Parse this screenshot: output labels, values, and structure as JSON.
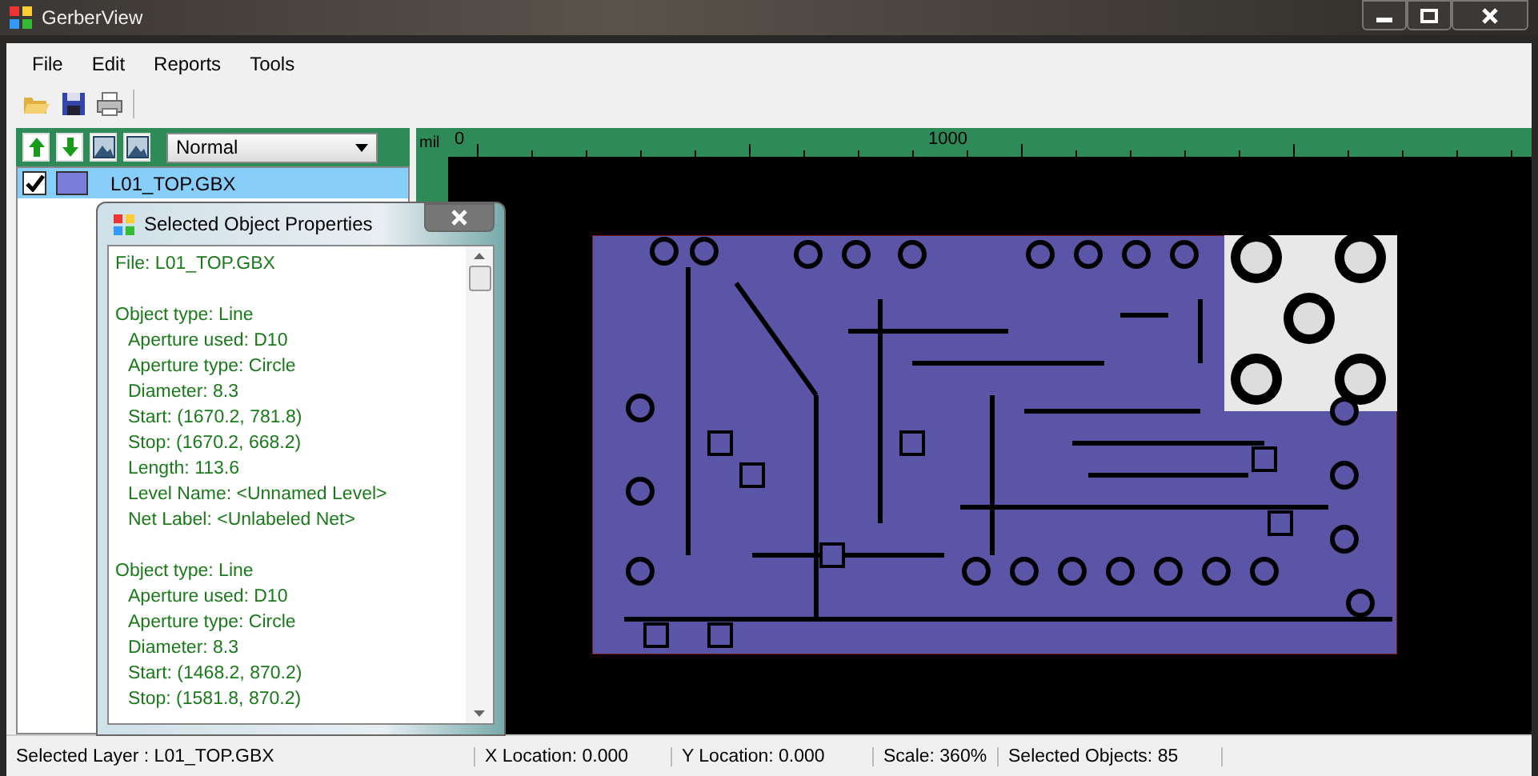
{
  "window": {
    "title": "GerberView"
  },
  "menu": [
    "File",
    "Edit",
    "Reports",
    "Tools"
  ],
  "layer_toolbar": {
    "view_mode": "Normal"
  },
  "layers": [
    {
      "name": "L01_TOP.GBX",
      "checked": true,
      "selected": true,
      "color": "#7b7bdb"
    }
  ],
  "ruler": {
    "unit": "mil",
    "labels": [
      "0",
      "1000"
    ]
  },
  "properties_dialog": {
    "title": "Selected Object Properties",
    "groups": [
      {
        "lines": [
          "File: L01_TOP.GBX"
        ]
      },
      {
        "lines": [
          "Object type: Line",
          "Aperture used: D10",
          "Aperture type: Circle",
          "Diameter: 8.3",
          "Start: (1670.2, 781.8)",
          "Stop: (1670.2, 668.2)",
          "Length: 113.6",
          "Level Name: <Unnamed Level>",
          "Net Label: <Unlabeled Net>"
        ]
      },
      {
        "lines": [
          "Object type: Line",
          "Aperture used: D10",
          "Aperture type: Circle",
          "Diameter: 8.3",
          "Start: (1468.2, 870.2)",
          "Stop: (1581.8, 870.2)"
        ]
      }
    ]
  },
  "status_bar": [
    "Selected Layer :  L01_TOP.GBX",
    "X Location:  0.000",
    "Y Location:  0.000",
    "Scale:  360%",
    "Selected Objects:  85"
  ]
}
